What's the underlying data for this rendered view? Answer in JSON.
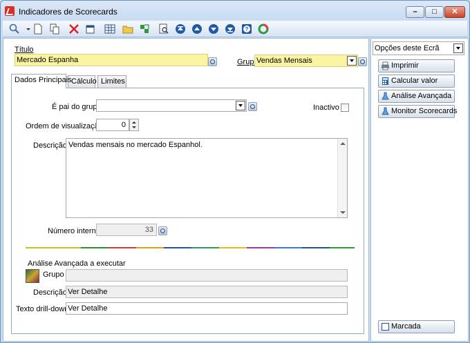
{
  "window": {
    "title": "Indicadores de Scorecards",
    "min_glyph": "–",
    "max_glyph": "□",
    "close_glyph": "✕"
  },
  "toolbar": {
    "icons": [
      "search-icon",
      "new-document-icon",
      "copy-icon",
      "delete-icon",
      "properties-icon",
      "grid-icon",
      "folder-icon",
      "refresh-icon",
      "preview-icon",
      "first-record-icon",
      "previous-record-icon",
      "next-record-icon",
      "last-record-icon",
      "help-icon",
      "recycle-icon"
    ]
  },
  "form": {
    "titulo_label": "Título",
    "titulo_value": "Mercado Espanha",
    "grupo_label": "Grupo",
    "grupo_value": "Vendas Mensais"
  },
  "tabs": [
    {
      "label": "Dados Principais",
      "active": true
    },
    {
      "label": "Cálculo",
      "active": false
    },
    {
      "label": "Limites",
      "active": false
    }
  ],
  "dados": {
    "e_pai_label": "É pai do grupo",
    "e_pai_value": "",
    "inactivo_label": "Inactivo",
    "ordem_label": "Ordem de visualização",
    "ordem_value": "0",
    "descricao_label": "Descrição",
    "descricao_value": "Vendas mensais no mercado Espanhol.",
    "numero_label": "Número interno",
    "numero_value": "33"
  },
  "analise": {
    "section_label": "Análise Avançada a executar",
    "grupo_label": "Grupo",
    "grupo_value": "",
    "descricao_label": "Descrição",
    "descricao_value": "Ver Detalhe",
    "drill_label": "Texto drill-down",
    "drill_value": "Ver Detalhe"
  },
  "side": {
    "options_label": "Opções deste Ecrã",
    "buttons": [
      "Imprimir",
      "Calcular valor",
      "Análise Avançada",
      "Monitor Scorecards"
    ],
    "marcada_label": "Marcada"
  },
  "colors": {
    "field_yellow": "#fbf4a1",
    "accent": "#e02b20"
  }
}
